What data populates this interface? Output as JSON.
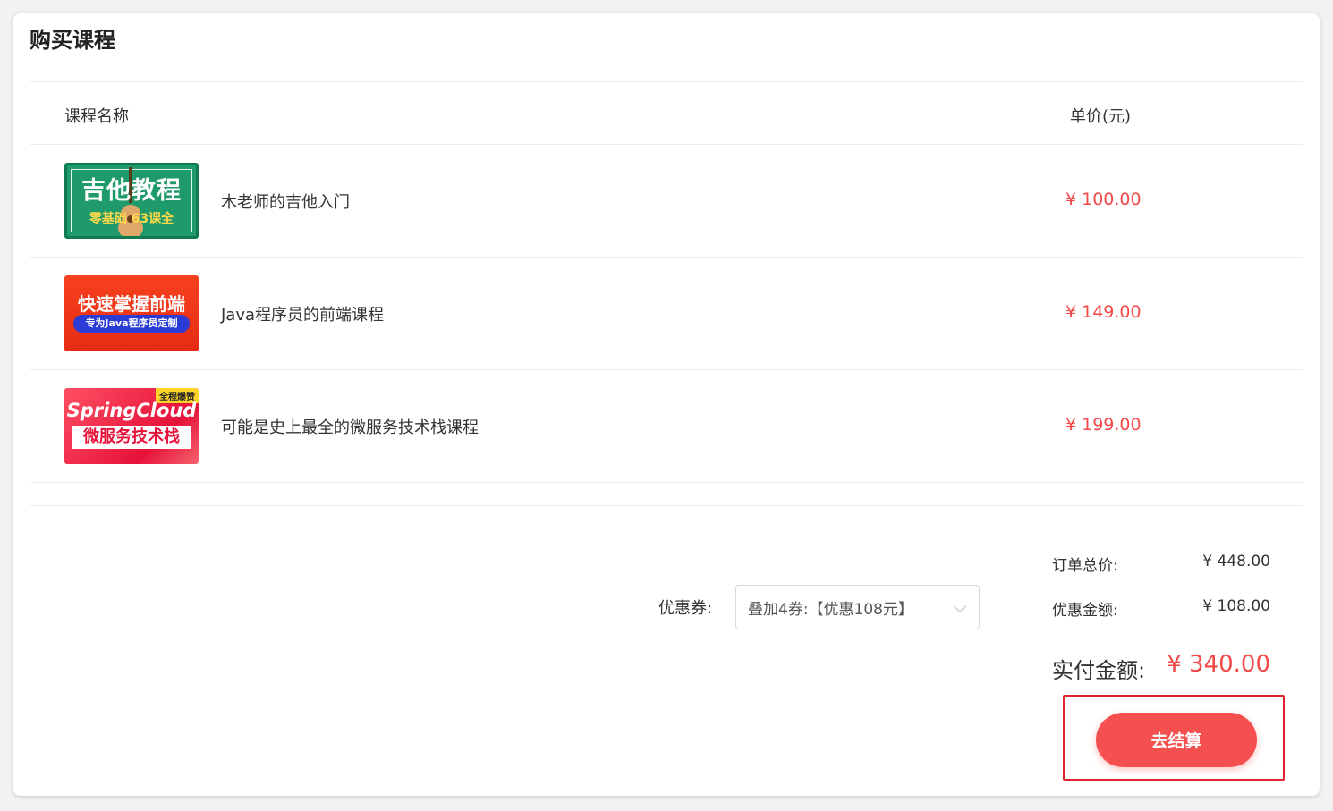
{
  "page": {
    "title": "购买课程"
  },
  "table": {
    "headers": {
      "name": "课程名称",
      "price": "单价(元)"
    },
    "rows": [
      {
        "title": "木老师的吉他入门",
        "price": "¥ 100.00",
        "thumb": {
          "line1": "吉他教程",
          "line2": "零基础  63课全"
        }
      },
      {
        "title": "Java程序员的前端课程",
        "price": "¥ 149.00",
        "thumb": {
          "line1": "快速掌握前端",
          "line2": "专为Java程序员定制"
        }
      },
      {
        "title": "可能是史上最全的微服务技术栈课程",
        "price": "¥ 199.00",
        "thumb": {
          "tag": "全程爆赞",
          "line1": "SpringCloud",
          "line2": "微服务技术栈"
        }
      }
    ]
  },
  "summary": {
    "coupon_label": "优惠券:",
    "coupon_selected": "叠加4券:【优惠108元】",
    "order_total_label": "订单总价:",
    "order_total_value": "¥ 448.00",
    "discount_label": "优惠金额:",
    "discount_value": "¥ 108.00",
    "pay_label": "实付金额:",
    "pay_value": "¥ 340.00",
    "checkout_label": "去结算"
  },
  "colors": {
    "accent": "#f55050",
    "price": "#f24a4a",
    "highlight": "#e0242f"
  }
}
